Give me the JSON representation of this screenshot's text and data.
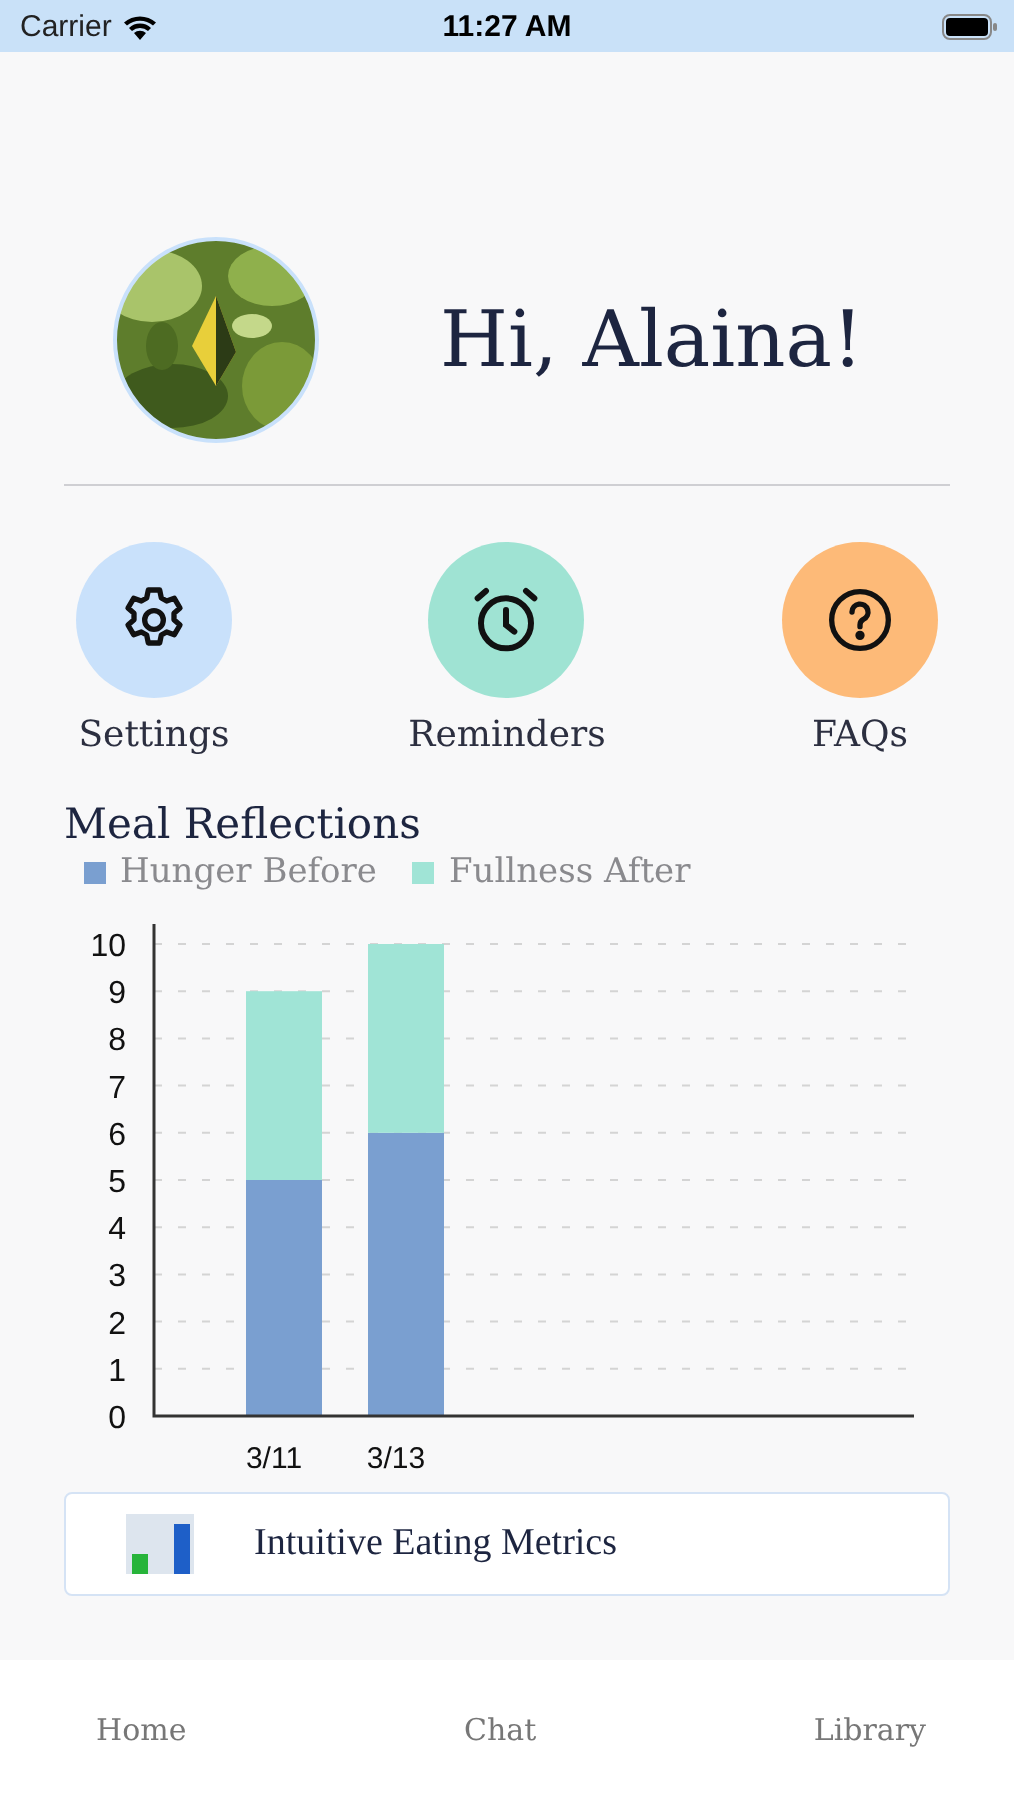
{
  "status_bar": {
    "carrier": "Carrier",
    "time": "11:27 AM"
  },
  "header": {
    "greeting": "Hi, Alaina!"
  },
  "actions": [
    {
      "label": "Settings",
      "kind": "gear",
      "color": "#c9e1fb"
    },
    {
      "label": "Reminders",
      "kind": "alarm",
      "color": "#9fe3d3"
    },
    {
      "label": "FAQs",
      "kind": "question",
      "color": "#fdba78"
    }
  ],
  "meal_reflections": {
    "title": "Meal Reflections",
    "chart_data": {
      "type": "bar",
      "stacked": true,
      "categories": [
        "3/11",
        "3/13"
      ],
      "series": [
        {
          "name": "Hunger Before",
          "color": "#7a9fd0",
          "values": [
            5,
            6
          ]
        },
        {
          "name": "Fullness After",
          "color": "#a0e4d6",
          "values": [
            4,
            4
          ]
        }
      ],
      "ylim": [
        0,
        10
      ],
      "grid": true,
      "yticks": [
        0,
        1,
        2,
        3,
        4,
        5,
        6,
        7,
        8,
        9,
        10
      ]
    }
  },
  "card": {
    "title": "Intuitive Eating Metrics"
  },
  "tab_bar": [
    {
      "label": "Home"
    },
    {
      "label": "Chat"
    },
    {
      "label": "Library"
    }
  ]
}
